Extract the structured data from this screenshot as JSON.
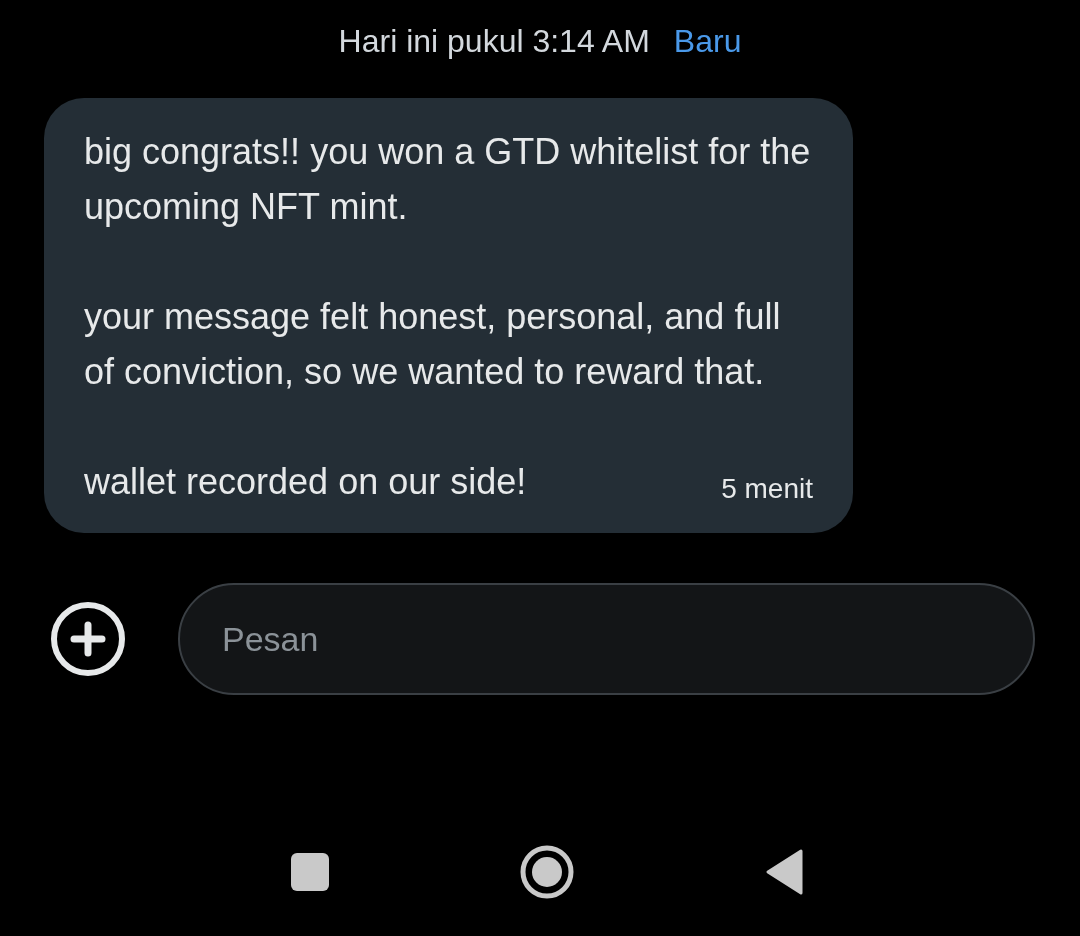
{
  "header": {
    "timestamp": "Hari ini pukul 3:14 AM",
    "badge": "Baru"
  },
  "message": {
    "paragraphs": [
      "big congrats!! you won a GTD whitelist for the upcoming NFT mint.",
      "your message felt honest, personal, and full of conviction, so we wanted to reward that.",
      "wallet recorded on our side!"
    ],
    "time": "5 menit"
  },
  "composer": {
    "placeholder": "Pesan"
  }
}
